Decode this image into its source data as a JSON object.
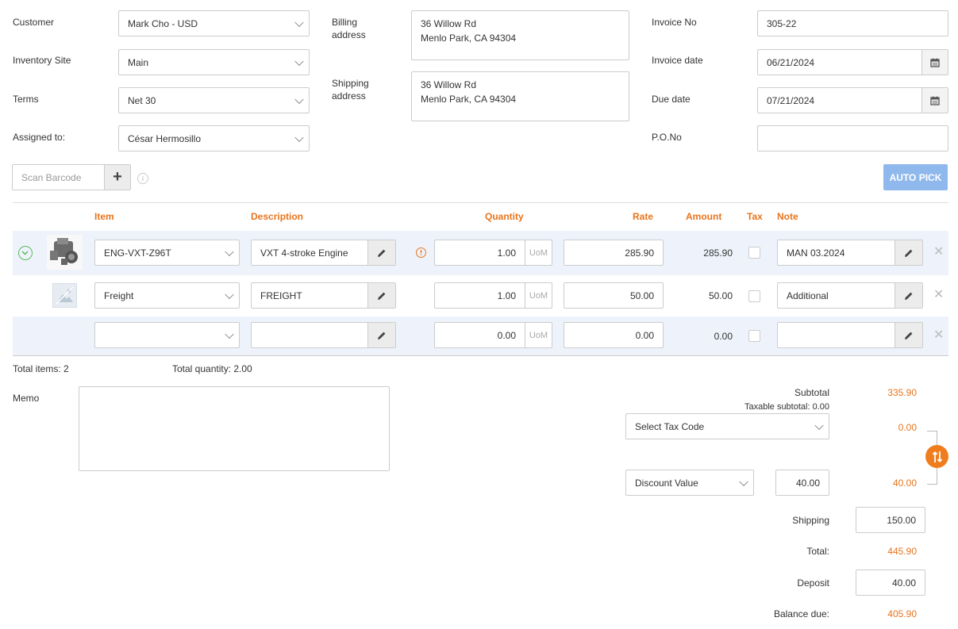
{
  "header": {
    "customer_label": "Customer",
    "customer_value": "Mark Cho - USD",
    "inventory_label": "Inventory Site",
    "inventory_value": "Main",
    "terms_label": "Terms",
    "terms_value": "Net 30",
    "assigned_label": "Assigned to:",
    "assigned_value": "César Hermosillo",
    "billing_label_1": "Billing",
    "billing_label_2": "address",
    "billing_line1": "36 Willow Rd",
    "billing_line2": "Menlo Park, CA 94304",
    "shipping_label_1": "Shipping",
    "shipping_label_2": "address",
    "shipping_line1": "36 Willow Rd",
    "shipping_line2": "Menlo Park, CA 94304",
    "invoice_no_label": "Invoice No",
    "invoice_no_value": "305-22",
    "invoice_date_label": "Invoice date",
    "invoice_date_value": "06/21/2024",
    "due_date_label": "Due date",
    "due_date_value": "07/21/2024",
    "po_label": "P.O.No",
    "po_value": ""
  },
  "scan": {
    "placeholder": "Scan Barcode",
    "add_symbol": "+",
    "auto_pick_label": "AUTO PICK"
  },
  "table": {
    "headers": {
      "item": "Item",
      "description": "Description",
      "quantity": "Quantity",
      "rate": "Rate",
      "amount": "Amount",
      "tax": "Tax",
      "note": "Note"
    },
    "rows": [
      {
        "item": "ENG-VXT-Z96T",
        "description": "VXT 4-stroke Engine",
        "quantity": "1.00",
        "uom": "UoM",
        "rate": "285.90",
        "amount": "285.90",
        "note": "MAN 03.2024"
      },
      {
        "item": "Freight",
        "description": "FREIGHT",
        "quantity": "1.00",
        "uom": "UoM",
        "rate": "50.00",
        "amount": "50.00",
        "note": "Additional"
      },
      {
        "item": "",
        "description": "",
        "quantity": "0.00",
        "uom": "UoM",
        "rate": "0.00",
        "amount": "0.00",
        "note": ""
      }
    ]
  },
  "summary": {
    "total_items": "Total items: 2",
    "total_quantity": "Total quantity: 2.00",
    "memo_label": "Memo",
    "memo_value": ""
  },
  "totals": {
    "subtotal_label": "Subtotal",
    "subtotal_value": "335.90",
    "taxable_subtotal": "Taxable subtotal: 0.00",
    "tax_code_placeholder": "Select Tax Code",
    "tax_value": "0.00",
    "discount_type": "Discount Value",
    "discount_input": "40.00",
    "discount_value": "40.00",
    "shipping_label": "Shipping",
    "shipping_input": "150.00",
    "total_label": "Total:",
    "total_value": "445.90",
    "deposit_label": "Deposit",
    "deposit_input": "40.00",
    "balance_label": "Balance due:",
    "balance_value": "405.90"
  },
  "colors": {
    "accent": "#e8741c",
    "auto_pick_bg": "#8fb8ec",
    "row_highlight": "#eef3fb"
  }
}
